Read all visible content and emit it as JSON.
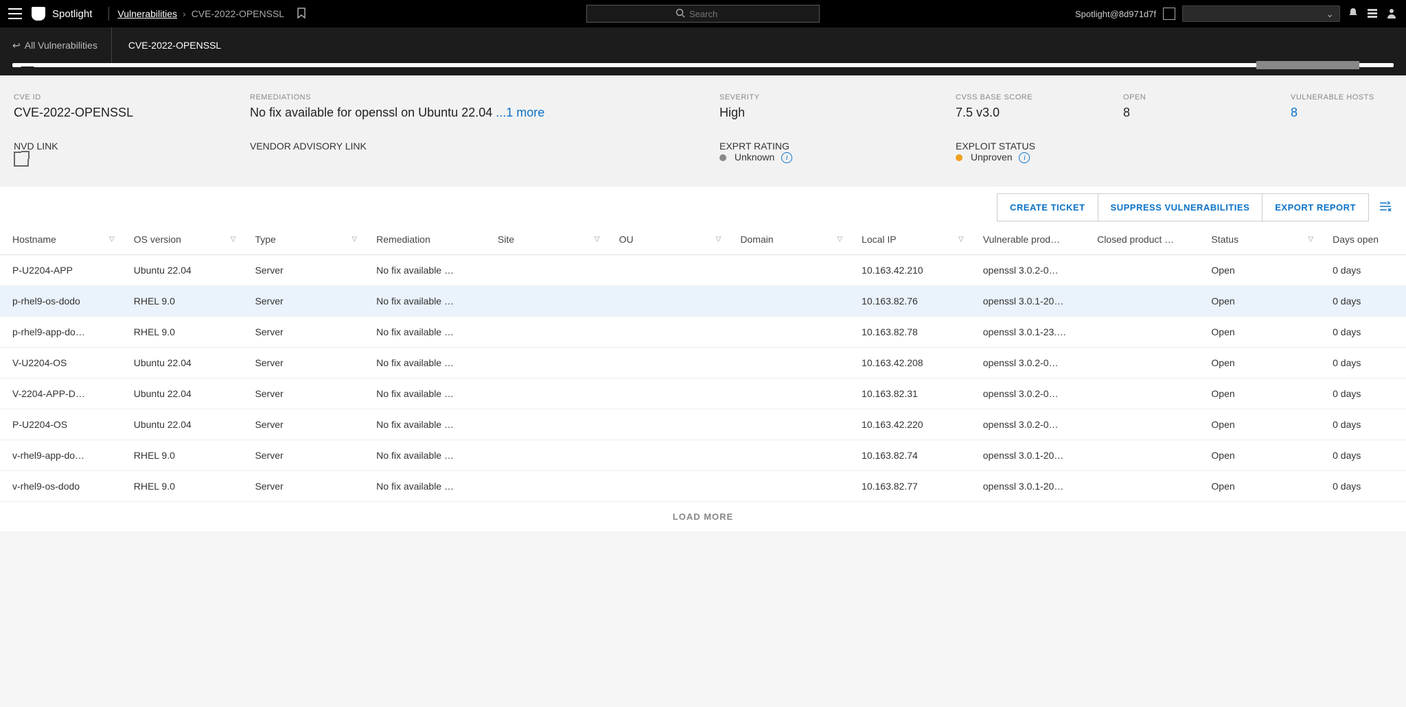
{
  "header": {
    "app_name": "Spotlight",
    "breadcrumb_root": "Vulnerabilities",
    "breadcrumb_current": "CVE-2022-OPENSSL",
    "search_placeholder": "Search",
    "user_context": "Spotlight@8d971d7f"
  },
  "subnav": {
    "back_label": "All Vulnerabilities",
    "tab_label": "CVE-2022-OPENSSL"
  },
  "details": {
    "cve_id_label": "CVE ID",
    "cve_id_value": "CVE-2022-OPENSSL",
    "remediations_label": "REMEDIATIONS",
    "remediations_value": "No fix available for openssl on Ubuntu 22.04",
    "remediations_more": "...1 more",
    "severity_label": "SEVERITY",
    "severity_value": "High",
    "cvss_label": "CVSS BASE SCORE",
    "cvss_value": "7.5 v3.0",
    "open_label": "OPEN",
    "open_value": "8",
    "vuln_hosts_label": "VULNERABLE HOSTS",
    "vuln_hosts_value": "8",
    "nvd_label": "NVD LINK",
    "vendor_label": "VENDOR ADVISORY LINK",
    "exprt_label": "EXPRT RATING",
    "exprt_value": "Unknown",
    "exploit_label": "EXPLOIT STATUS",
    "exploit_value": "Unproven"
  },
  "actions": {
    "create_ticket": "CREATE TICKET",
    "suppress": "SUPPRESS VULNERABILITIES",
    "export": "EXPORT REPORT"
  },
  "columns": {
    "hostname": "Hostname",
    "os": "OS version",
    "type": "Type",
    "remediation": "Remediation",
    "site": "Site",
    "ou": "OU",
    "domain": "Domain",
    "local_ip": "Local IP",
    "vuln_prod": "Vulnerable prod…",
    "closed_prod": "Closed product …",
    "status": "Status",
    "days_open": "Days open"
  },
  "rows": [
    {
      "hostname": "P-U2204-APP",
      "os": "Ubuntu 22.04",
      "type": "Server",
      "remediation": "No fix available …",
      "site": "",
      "ou": "",
      "domain": "",
      "ip": "10.163.42.210",
      "vp": "openssl 3.0.2-0…",
      "cp": "",
      "status": "Open",
      "days": "0 days",
      "hl": false
    },
    {
      "hostname": "p-rhel9-os-dodo",
      "os": "RHEL 9.0",
      "type": "Server",
      "remediation": "No fix available …",
      "site": "",
      "ou": "",
      "domain": "",
      "ip": "10.163.82.76",
      "vp": "openssl 3.0.1-20…",
      "cp": "",
      "status": "Open",
      "days": "0 days",
      "hl": true
    },
    {
      "hostname": "p-rhel9-app-do…",
      "os": "RHEL 9.0",
      "type": "Server",
      "remediation": "No fix available …",
      "site": "",
      "ou": "",
      "domain": "",
      "ip": "10.163.82.78",
      "vp": "openssl 3.0.1-23.…",
      "cp": "",
      "status": "Open",
      "days": "0 days",
      "hl": false
    },
    {
      "hostname": "V-U2204-OS",
      "os": "Ubuntu 22.04",
      "type": "Server",
      "remediation": "No fix available …",
      "site": "",
      "ou": "",
      "domain": "",
      "ip": "10.163.42.208",
      "vp": "openssl 3.0.2-0…",
      "cp": "",
      "status": "Open",
      "days": "0 days",
      "hl": false
    },
    {
      "hostname": "V-2204-APP-D…",
      "os": "Ubuntu 22.04",
      "type": "Server",
      "remediation": "No fix available …",
      "site": "",
      "ou": "",
      "domain": "",
      "ip": "10.163.82.31",
      "vp": "openssl 3.0.2-0…",
      "cp": "",
      "status": "Open",
      "days": "0 days",
      "hl": false
    },
    {
      "hostname": "P-U2204-OS",
      "os": "Ubuntu 22.04",
      "type": "Server",
      "remediation": "No fix available …",
      "site": "",
      "ou": "",
      "domain": "",
      "ip": "10.163.42.220",
      "vp": "openssl 3.0.2-0…",
      "cp": "",
      "status": "Open",
      "days": "0 days",
      "hl": false
    },
    {
      "hostname": "v-rhel9-app-do…",
      "os": "RHEL 9.0",
      "type": "Server",
      "remediation": "No fix available …",
      "site": "",
      "ou": "",
      "domain": "",
      "ip": "10.163.82.74",
      "vp": "openssl 3.0.1-20…",
      "cp": "",
      "status": "Open",
      "days": "0 days",
      "hl": false
    },
    {
      "hostname": "v-rhel9-os-dodo",
      "os": "RHEL 9.0",
      "type": "Server",
      "remediation": "No fix available …",
      "site": "",
      "ou": "",
      "domain": "",
      "ip": "10.163.82.77",
      "vp": "openssl 3.0.1-20…",
      "cp": "",
      "status": "Open",
      "days": "0 days",
      "hl": false
    }
  ],
  "load_more": "LOAD MORE"
}
